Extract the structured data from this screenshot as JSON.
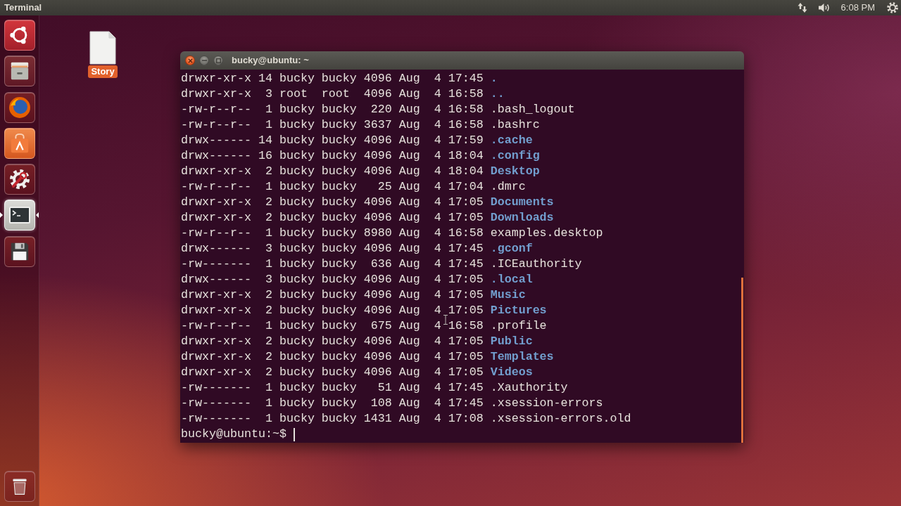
{
  "top_panel": {
    "app_title": "Terminal",
    "clock": "6:08 PM"
  },
  "launcher": {
    "items": [
      {
        "kind": "dash",
        "selected": false
      },
      {
        "kind": "files",
        "selected": false
      },
      {
        "kind": "browser",
        "selected": false
      },
      {
        "kind": "store",
        "selected": false
      },
      {
        "kind": "settings",
        "selected": false
      },
      {
        "kind": "terminal",
        "selected": true
      },
      {
        "kind": "disk",
        "selected": false
      },
      {
        "kind": "trash",
        "selected": false
      }
    ]
  },
  "desktop_icons": [
    {
      "label": "Story",
      "selected": true
    }
  ],
  "terminal": {
    "title": "bucky@ubuntu: ~",
    "listing": [
      {
        "permissions": "drwxr-xr-x",
        "links": "14",
        "owner": "bucky",
        "group": "bucky",
        "size": "4096",
        "month": "Aug",
        "day": "4",
        "time": "17:45",
        "name": ".",
        "kind": "directory"
      },
      {
        "permissions": "drwxr-xr-x",
        "links": "3",
        "owner": "root",
        "group": "root",
        "size": "4096",
        "month": "Aug",
        "day": "4",
        "time": "16:58",
        "name": "..",
        "kind": "directory"
      },
      {
        "permissions": "-rw-r--r--",
        "links": "1",
        "owner": "bucky",
        "group": "bucky",
        "size": "220",
        "month": "Aug",
        "day": "4",
        "time": "16:58",
        "name": ".bash_logout",
        "kind": "file"
      },
      {
        "permissions": "-rw-r--r--",
        "links": "1",
        "owner": "bucky",
        "group": "bucky",
        "size": "3637",
        "month": "Aug",
        "day": "4",
        "time": "16:58",
        "name": ".bashrc",
        "kind": "file"
      },
      {
        "permissions": "drwx------",
        "links": "14",
        "owner": "bucky",
        "group": "bucky",
        "size": "4096",
        "month": "Aug",
        "day": "4",
        "time": "17:59",
        "name": ".cache",
        "kind": "directory"
      },
      {
        "permissions": "drwx------",
        "links": "16",
        "owner": "bucky",
        "group": "bucky",
        "size": "4096",
        "month": "Aug",
        "day": "4",
        "time": "18:04",
        "name": ".config",
        "kind": "directory"
      },
      {
        "permissions": "drwxr-xr-x",
        "links": "2",
        "owner": "bucky",
        "group": "bucky",
        "size": "4096",
        "month": "Aug",
        "day": "4",
        "time": "18:04",
        "name": "Desktop",
        "kind": "directory"
      },
      {
        "permissions": "-rw-r--r--",
        "links": "1",
        "owner": "bucky",
        "group": "bucky",
        "size": "25",
        "month": "Aug",
        "day": "4",
        "time": "17:04",
        "name": ".dmrc",
        "kind": "file"
      },
      {
        "permissions": "drwxr-xr-x",
        "links": "2",
        "owner": "bucky",
        "group": "bucky",
        "size": "4096",
        "month": "Aug",
        "day": "4",
        "time": "17:05",
        "name": "Documents",
        "kind": "directory"
      },
      {
        "permissions": "drwxr-xr-x",
        "links": "2",
        "owner": "bucky",
        "group": "bucky",
        "size": "4096",
        "month": "Aug",
        "day": "4",
        "time": "17:05",
        "name": "Downloads",
        "kind": "directory"
      },
      {
        "permissions": "-rw-r--r--",
        "links": "1",
        "owner": "bucky",
        "group": "bucky",
        "size": "8980",
        "month": "Aug",
        "day": "4",
        "time": "16:58",
        "name": "examples.desktop",
        "kind": "file"
      },
      {
        "permissions": "drwx------",
        "links": "3",
        "owner": "bucky",
        "group": "bucky",
        "size": "4096",
        "month": "Aug",
        "day": "4",
        "time": "17:45",
        "name": ".gconf",
        "kind": "directory"
      },
      {
        "permissions": "-rw-------",
        "links": "1",
        "owner": "bucky",
        "group": "bucky",
        "size": "636",
        "month": "Aug",
        "day": "4",
        "time": "17:45",
        "name": ".ICEauthority",
        "kind": "file"
      },
      {
        "permissions": "drwx------",
        "links": "3",
        "owner": "bucky",
        "group": "bucky",
        "size": "4096",
        "month": "Aug",
        "day": "4",
        "time": "17:05",
        "name": ".local",
        "kind": "directory"
      },
      {
        "permissions": "drwxr-xr-x",
        "links": "2",
        "owner": "bucky",
        "group": "bucky",
        "size": "4096",
        "month": "Aug",
        "day": "4",
        "time": "17:05",
        "name": "Music",
        "kind": "directory"
      },
      {
        "permissions": "drwxr-xr-x",
        "links": "2",
        "owner": "bucky",
        "group": "bucky",
        "size": "4096",
        "month": "Aug",
        "day": "4",
        "time": "17:05",
        "name": "Pictures",
        "kind": "directory"
      },
      {
        "permissions": "-rw-r--r--",
        "links": "1",
        "owner": "bucky",
        "group": "bucky",
        "size": "675",
        "month": "Aug",
        "day": "4",
        "time": "16:58",
        "name": ".profile",
        "kind": "file"
      },
      {
        "permissions": "drwxr-xr-x",
        "links": "2",
        "owner": "bucky",
        "group": "bucky",
        "size": "4096",
        "month": "Aug",
        "day": "4",
        "time": "17:05",
        "name": "Public",
        "kind": "directory"
      },
      {
        "permissions": "drwxr-xr-x",
        "links": "2",
        "owner": "bucky",
        "group": "bucky",
        "size": "4096",
        "month": "Aug",
        "day": "4",
        "time": "17:05",
        "name": "Templates",
        "kind": "directory"
      },
      {
        "permissions": "drwxr-xr-x",
        "links": "2",
        "owner": "bucky",
        "group": "bucky",
        "size": "4096",
        "month": "Aug",
        "day": "4",
        "time": "17:05",
        "name": "Videos",
        "kind": "directory"
      },
      {
        "permissions": "-rw-------",
        "links": "1",
        "owner": "bucky",
        "group": "bucky",
        "size": "51",
        "month": "Aug",
        "day": "4",
        "time": "17:45",
        "name": ".Xauthority",
        "kind": "file"
      },
      {
        "permissions": "-rw-------",
        "links": "1",
        "owner": "bucky",
        "group": "bucky",
        "size": "108",
        "month": "Aug",
        "day": "4",
        "time": "17:45",
        "name": ".xsession-errors",
        "kind": "file"
      },
      {
        "permissions": "-rw-------",
        "links": "1",
        "owner": "bucky",
        "group": "bucky",
        "size": "1431",
        "month": "Aug",
        "day": "4",
        "time": "17:08",
        "name": ".xsession-errors.old",
        "kind": "file"
      }
    ],
    "prompt": "bucky@ubuntu:~$"
  }
}
